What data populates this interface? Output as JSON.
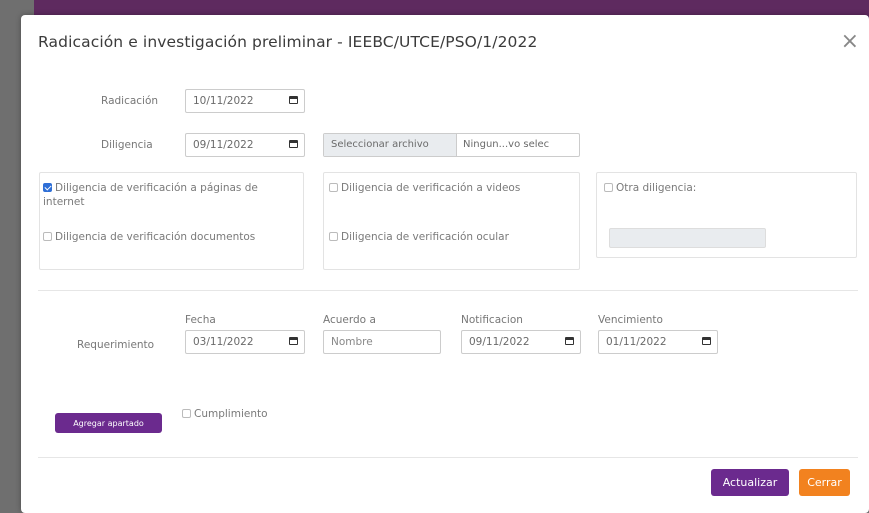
{
  "modal": {
    "title": "Radicación e investigación preliminar - IEEBC/UTCE/PSO/1/2022",
    "close_symbol": "×"
  },
  "radicacion": {
    "label": "Radicación",
    "value": "10/11/2022"
  },
  "diligencia": {
    "label": "Diligencia",
    "value": "09/11/2022",
    "file_button": "Seleccionar archivo",
    "file_name": "Ningun...vo selec"
  },
  "options": [
    {
      "label": "Diligencia de verificación a páginas de internet",
      "checked": true
    },
    {
      "label": "Diligencia de verificación documentos",
      "checked": false
    },
    {
      "label": "Diligencia de verificación a videos",
      "checked": false
    },
    {
      "label": "Diligencia de verificación ocular",
      "checked": false
    },
    {
      "label": "Otra diligencia:",
      "checked": false
    }
  ],
  "requerimiento": {
    "label": "Requerimiento",
    "fecha_label": "Fecha",
    "fecha_value": "03/11/2022",
    "acuerdo_label": "Acuerdo a",
    "acuerdo_placeholder": "Nombre",
    "notificacion_label": "Notificacion",
    "notificacion_value": "09/11/2022",
    "vencimiento_label": "Vencimiento",
    "vencimiento_value": "01/11/2022"
  },
  "agregar_button": "Agregar apartado",
  "cumplimiento_label": "Cumplimiento",
  "footer": {
    "actualizar": "Actualizar",
    "cerrar": "Cerrar"
  },
  "colors": {
    "purple": "#6b2a8e",
    "orange": "#f2821f",
    "check_blue": "#2f6fd6"
  }
}
